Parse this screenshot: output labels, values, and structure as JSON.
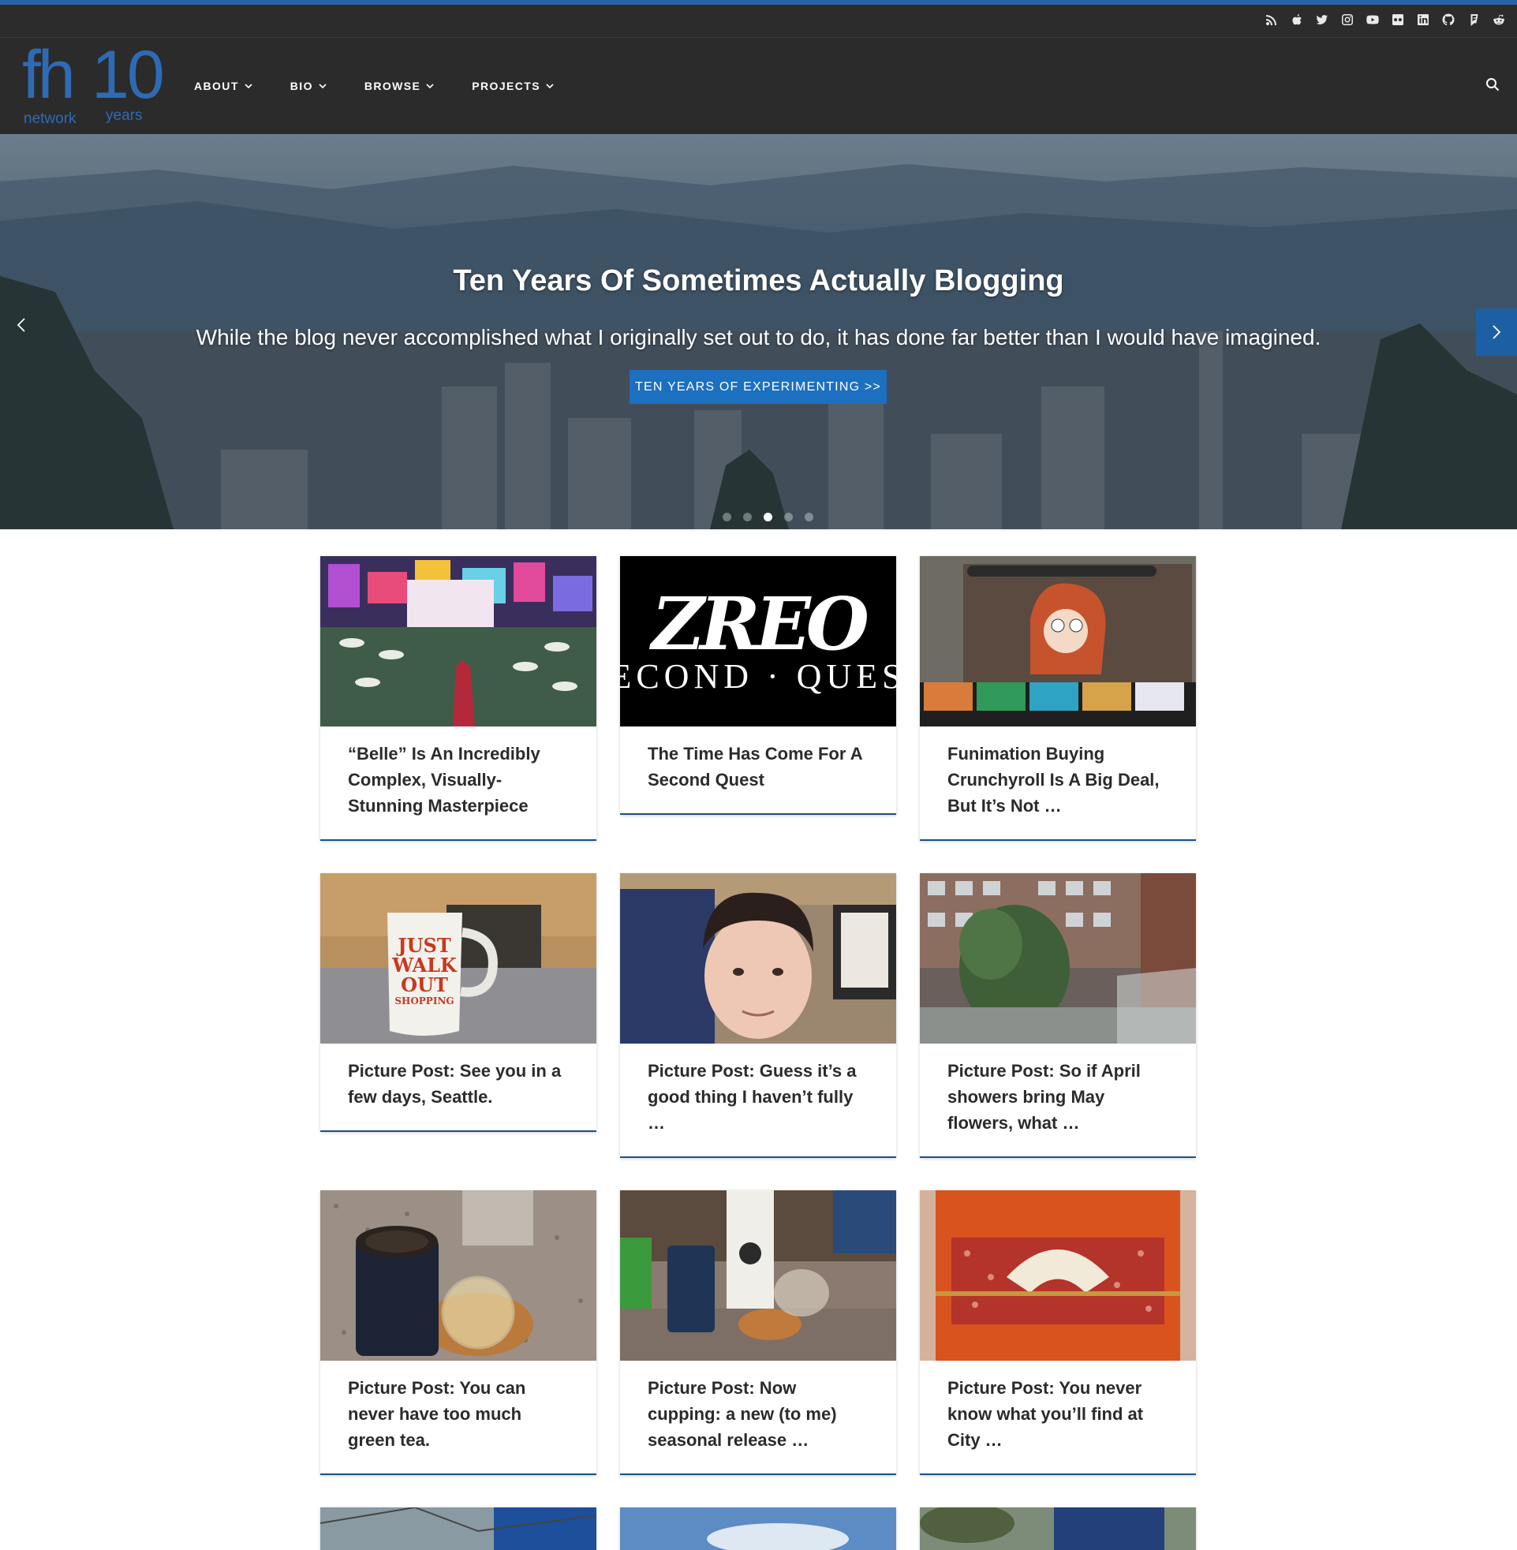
{
  "social": [
    "rss-icon",
    "apple-icon",
    "twitter-icon",
    "instagram-icon",
    "youtube-icon",
    "flickr-icon",
    "linkedin-icon",
    "github-icon",
    "foursquare-icon",
    "reddit-icon"
  ],
  "logo": {
    "main": "fh",
    "number": "10",
    "sub_left": "network",
    "sub_right": "years"
  },
  "nav": {
    "items": [
      "ABOUT",
      "BIO",
      "BROWSE",
      "PROJECTS"
    ]
  },
  "hero": {
    "title": "Ten Years Of Sometimes Actually Blogging",
    "subtitle": "While the blog never accomplished what I originally set out to do, it has done far better than I would have imagined.",
    "cta": "TEN YEARS OF EXPERIMENTING >>",
    "slide_count": 5,
    "active_slide": 3
  },
  "posts": [
    {
      "title": "“Belle” Is An Incredibly Complex, Visually-Stunning Masterpiece",
      "thumb": "belle-concert"
    },
    {
      "title": "The Time Has Come For A Second Quest",
      "thumb": "zreo-logo",
      "thumb_text": "ZREO",
      "thumb_sub": "ECOND · QUES"
    },
    {
      "title": "Funimation Buying Crunchyroll Is A Big Deal, But It’s Not …",
      "thumb": "anime-tv"
    },
    {
      "title": "Picture Post: See you in a few days, Seattle.",
      "thumb": "mug",
      "thumb_text": [
        "JUST",
        "WALK",
        "OUT",
        "SHOPPING"
      ]
    },
    {
      "title": "Picture Post: Guess it’s a good thing I haven’t fully …",
      "thumb": "selfie"
    },
    {
      "title": "Picture Post: So if April showers bring May flowers, what …",
      "thumb": "courtyard"
    },
    {
      "title": "Picture Post: You can never have too much green tea.",
      "thumb": "tea-tin"
    },
    {
      "title": "Picture Post: Now cupping: a new (to me) seasonal release …",
      "thumb": "tea-counter"
    },
    {
      "title": "Picture Post: You never know what you’ll find at City …",
      "thumb": "fan-box"
    }
  ],
  "colors": {
    "accent": "#2a62a8",
    "header_bg": "#2b2b2b",
    "cta": "#1d6fc0",
    "card_border": "#1a4f8b"
  }
}
